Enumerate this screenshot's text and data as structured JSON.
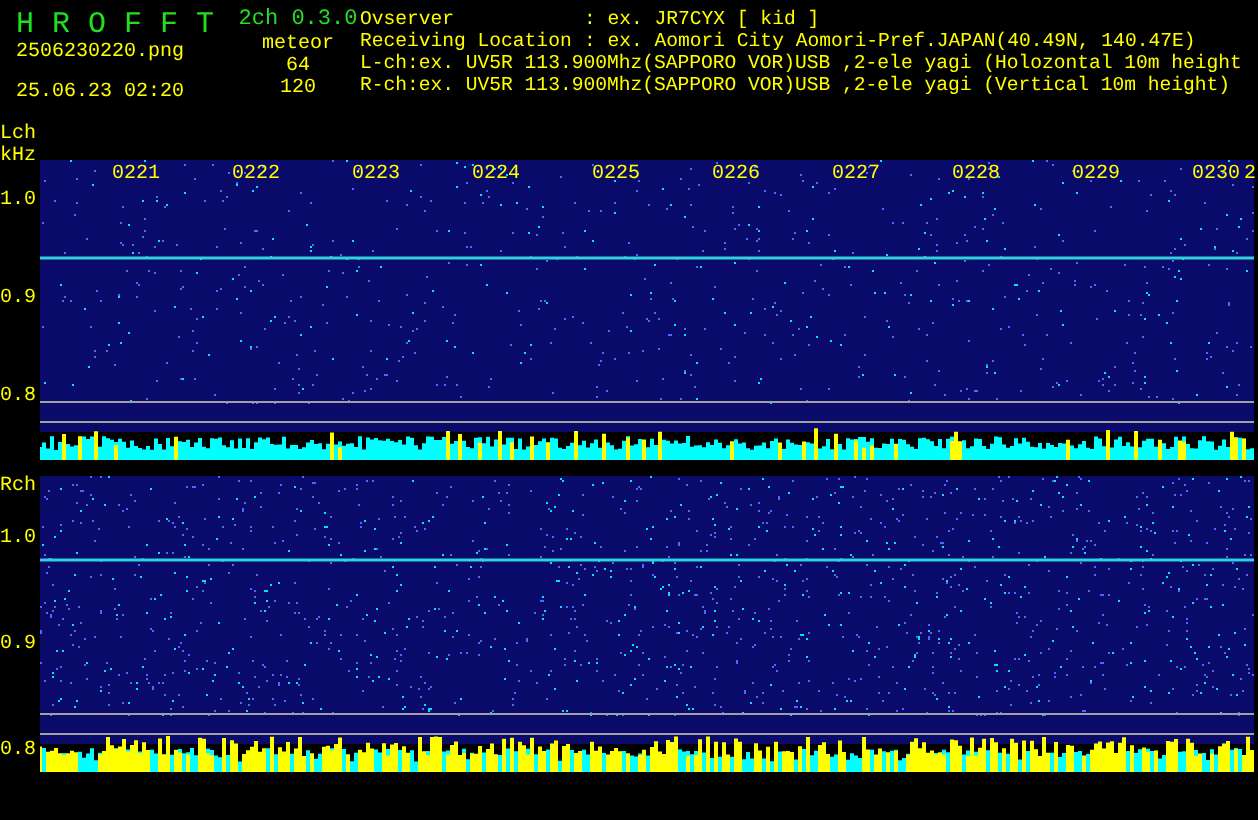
{
  "header": {
    "app_name": "H R O F F T",
    "version": "2ch 0.3.0",
    "file_name": "2506230220.png",
    "mode": "meteor",
    "datetime": "25.06.23 02:20",
    "l_count": "64",
    "r_count": "120",
    "info": [
      {
        "label": "Ovserver",
        "value": ": ex. JR7CYX [ kid ]"
      },
      {
        "label": "Receiving Location",
        "value": ": ex. Aomori City Aomori-Pref.JAPAN(40.49N, 140.47E)"
      },
      {
        "label": "L-ch:ex. UV5R 113.900Mhz(SAPPORO VOR)USB ,2-ele yagi (Holozontal 10m height"
      },
      {
        "label": "R-ch:ex. UV5R 113.900Mhz(SAPPORO VOR)USB ,2-ele yagi (Vertical 10m height)"
      }
    ]
  },
  "panels": [
    {
      "channel": "Lch",
      "unit": "kHz",
      "time_labels": [
        "0221",
        "0222",
        "0223",
        "0224",
        "0225",
        "0226",
        "0227",
        "0228",
        "0229",
        "0230",
        "2"
      ],
      "freq_labels": [
        "1.0",
        "0.9",
        "0.8"
      ]
    },
    {
      "channel": "Rch",
      "freq_labels": [
        "1.0",
        "0.9",
        "0.8"
      ]
    }
  ]
}
